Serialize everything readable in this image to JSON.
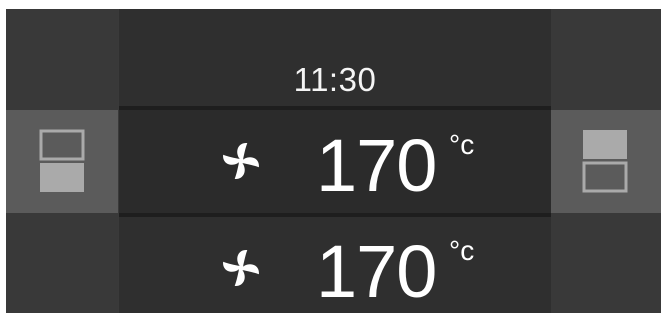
{
  "display": {
    "time": "11:30",
    "rows": [
      {
        "temperature": "170",
        "unit": "°c",
        "mode_icon": "fan-icon"
      },
      {
        "temperature": "170",
        "unit": "°c",
        "mode_icon": "fan-icon"
      }
    ]
  },
  "controls": {
    "left_button_icon": "lower-tray-selected-icon",
    "right_button_icon": "upper-tray-selected-icon"
  },
  "colors": {
    "panel": "#3a3a3a",
    "row_background": "#2f2f2f",
    "button_background": "#5b5b5b",
    "icon_fill": "#aaaaaa",
    "text": "#ffffff"
  }
}
